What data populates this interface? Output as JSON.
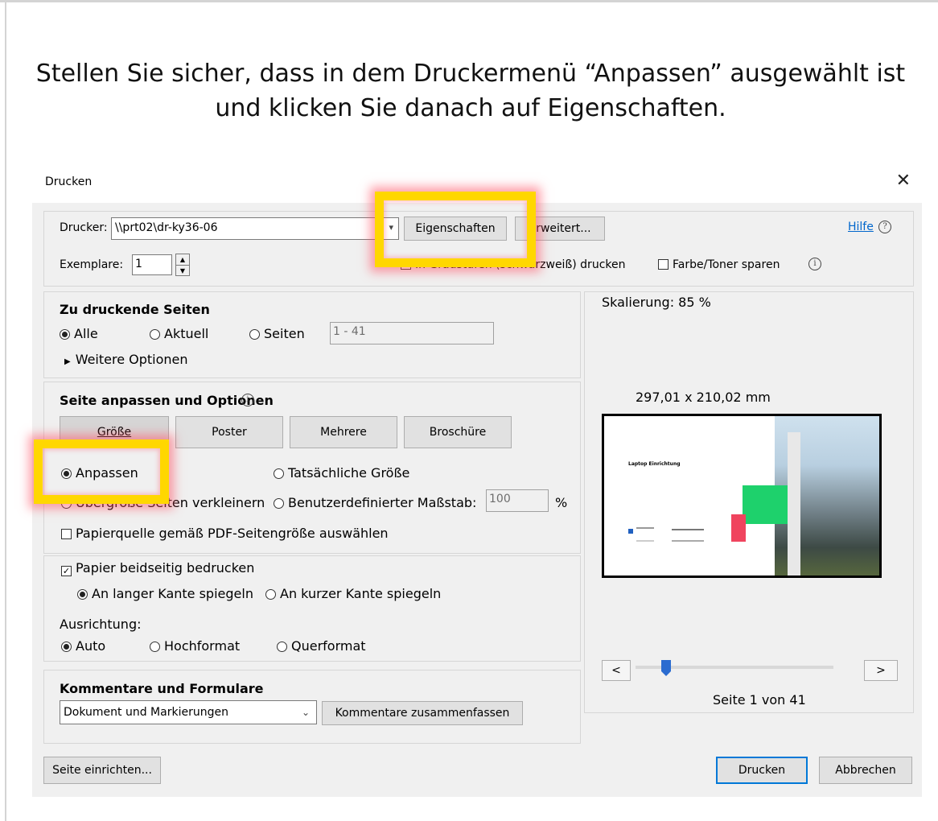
{
  "instruction": "Stellen Sie sicher, dass in dem Druckermenü “Anpassen” ausgewählt ist und klicken Sie danach auf Eigenschaften.",
  "dialog": {
    "title": "Drucken",
    "close_icon": "close-icon",
    "printer_label": "Drucker:",
    "printer_value": "\\\\prt02\\dr-ky36-06",
    "properties_button": "Eigenschaften",
    "advanced_button": "Erweitert...",
    "help_link": "Hilfe",
    "help_icon": "?",
    "copies_label": "Exemplare:",
    "copies_value": "1",
    "grayscale_label": "In Graustufen (schwarzweiß) drucken",
    "save_toner_label": "Farbe/Toner sparen",
    "info_icon": "i"
  },
  "pages_section": {
    "title": "Zu druckende Seiten",
    "all": "Alle",
    "current": "Aktuell",
    "pages": "Seiten",
    "pages_input": "1 - 41",
    "more_options": "Weitere Optionen"
  },
  "fit_section": {
    "title": "Seite anpassen und Optionen",
    "tabs": [
      "Größe",
      "Poster",
      "Mehrere",
      "Broschüre"
    ],
    "fit": "Anpassen",
    "actual_size": "Tatsächliche Größe",
    "shrink": "Übergroße Seiten verkleinern",
    "custom_scale": "Benutzerdefinierter Maßstab:",
    "custom_scale_value": "100",
    "percent": "%",
    "paper_source": "Papierquelle gemäß PDF-Seitengröße auswählen"
  },
  "duplex_section": {
    "duplex": "Papier beidseitig bedrucken",
    "long_edge": "An langer Kante spiegeln",
    "short_edge": "An kurzer Kante spiegeln",
    "orientation_label": "Ausrichtung:",
    "auto": "Auto",
    "portrait": "Hochformat",
    "landscape": "Querformat"
  },
  "comments_section": {
    "title": "Kommentare und Formulare",
    "select_value": "Dokument und Markierungen",
    "summarize_button": "Kommentare zusammenfassen"
  },
  "preview": {
    "scaling": "Skalierung:  85 %",
    "size": "297,01 x 210,02 mm",
    "doc_title": "Laptop Einrichtung",
    "page_info": "Seite 1 von 41",
    "prev": "<",
    "next": ">"
  },
  "footer": {
    "page_setup": "Seite einrichten...",
    "print": "Drucken",
    "cancel": "Abbrechen"
  },
  "colors": {
    "highlight": "#ffd700",
    "highlight_glow": "#ff5064",
    "accent": "#0078d7",
    "link": "#0066cc"
  }
}
